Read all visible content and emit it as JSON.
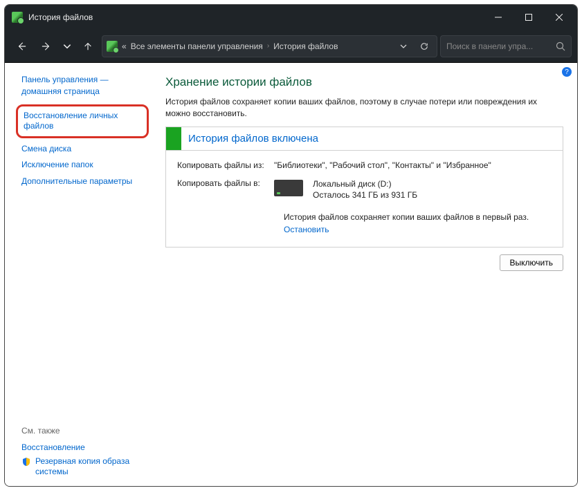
{
  "window": {
    "title": "История файлов"
  },
  "breadcrumb": {
    "prefix": "«",
    "item1": "Все элементы панели управления",
    "item2": "История файлов"
  },
  "search": {
    "placeholder": "Поиск в панели упра..."
  },
  "sidebar": {
    "home": "Панель управления — домашняя страница",
    "links": [
      "Восстановление личных файлов",
      "Смена диска",
      "Исключение папок",
      "Дополнительные параметры"
    ],
    "see_also": "См. также",
    "bottom_links": [
      "Восстановление",
      "Резервная копия образа системы"
    ]
  },
  "main": {
    "heading": "Хранение истории файлов",
    "description": "История файлов сохраняет копии ваших файлов, поэтому в случае потери или повреждения их можно восстановить.",
    "status_title": "История файлов включена",
    "copy_from_label": "Копировать файлы из:",
    "copy_from_value": "\"Библиотеки\", \"Рабочий стол\", \"Контакты\" и \"Избранное\"",
    "copy_to_label": "Копировать файлы в:",
    "disk_name": "Локальный диск (D:)",
    "disk_space": "Осталось 341 ГБ из 931 ГБ",
    "status_msg": "История файлов сохраняет копии ваших файлов в первый раз.",
    "stop": "Остановить",
    "turn_off": "Выключить"
  },
  "help": "?"
}
